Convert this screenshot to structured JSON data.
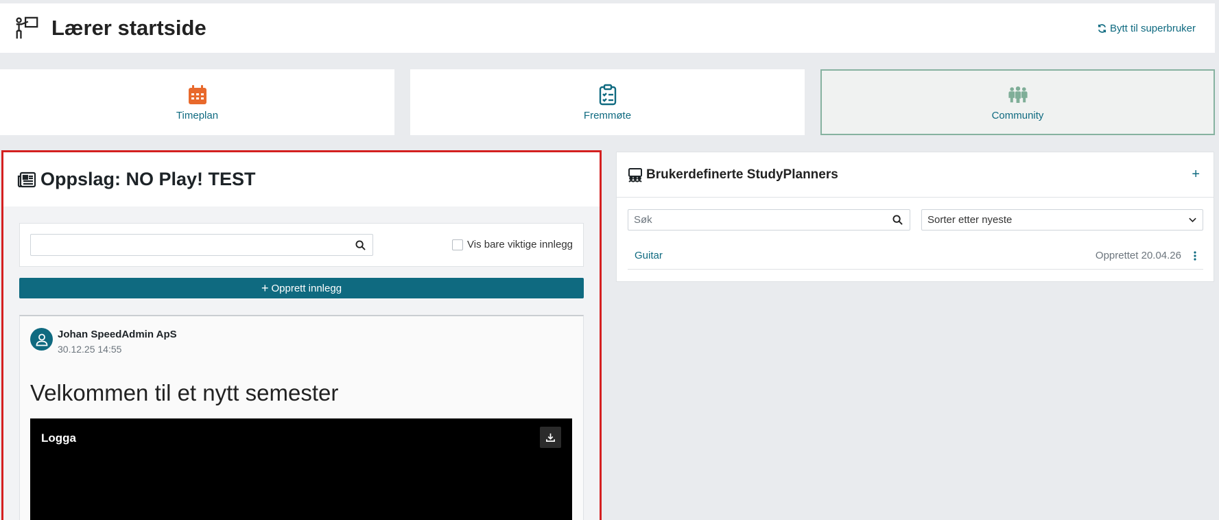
{
  "header": {
    "title": "Lærer startside",
    "switch_label": "Bytt til superbruker"
  },
  "tiles": [
    {
      "label": "Timeplan",
      "icon": "calendar-icon",
      "color": "#e8692c"
    },
    {
      "label": "Fremmøte",
      "icon": "clipboard-check-icon",
      "color": "#0f6a80"
    },
    {
      "label": "Community",
      "icon": "people-group-icon",
      "color": "#7fae98",
      "active": true
    }
  ],
  "bulletin": {
    "title": "Oppslag: NO Play! TEST",
    "search_value": "",
    "important_only_label": "Vis bare viktige innlegg",
    "create_label": "Opprett innlegg",
    "post": {
      "author": "Johan SpeedAdmin ApS",
      "date": "30.12.25 14:55",
      "title": "Velkommen til et nytt semester",
      "media_label": "Logga"
    }
  },
  "studyplanners": {
    "title": "Brukerdefinerte StudyPlanners",
    "add_label": "+",
    "search_placeholder": "Søk",
    "sort_selected": "Sorter etter nyeste",
    "items": [
      {
        "name": "Guitar",
        "created": "Opprettet 20.04.26"
      }
    ]
  },
  "colors": {
    "accent": "#0f6a80",
    "highlight_border": "#d42020",
    "active_tile_border": "#86b2a0"
  }
}
